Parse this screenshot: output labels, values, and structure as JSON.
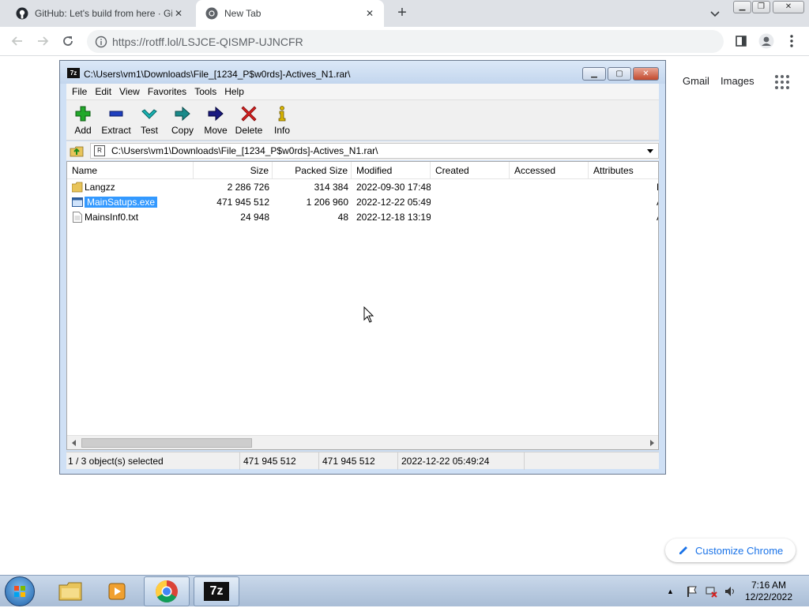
{
  "browser": {
    "tabs": [
      {
        "title": "GitHub: Let's build from here · GitHub",
        "active": false
      },
      {
        "title": "New Tab",
        "active": true
      }
    ],
    "url": "https://rotff.lol/LSJCE-QISMP-UJNCFR"
  },
  "google": {
    "gmail": "Gmail",
    "images": "Images",
    "customize": "Customize Chrome"
  },
  "sevenzip": {
    "title": "C:\\Users\\vm1\\Downloads\\File_[1234_P$w0rds]-Actives_N1.rar\\",
    "menu": [
      "File",
      "Edit",
      "View",
      "Favorites",
      "Tools",
      "Help"
    ],
    "toolbar": [
      {
        "label": "Add",
        "icon": "plus-icon",
        "color": "#22a82b"
      },
      {
        "label": "Extract",
        "icon": "minus-icon",
        "color": "#1f3fbf"
      },
      {
        "label": "Test",
        "icon": "check-icon",
        "color": "#19b3b3"
      },
      {
        "label": "Copy",
        "icon": "copy-arrow-icon",
        "color": "#1a8a8a"
      },
      {
        "label": "Move",
        "icon": "move-arrow-icon",
        "color": "#1a1a80"
      },
      {
        "label": "Delete",
        "icon": "delete-x-icon",
        "color": "#d42020"
      },
      {
        "label": "Info",
        "icon": "info-icon",
        "color": "#d8b400"
      }
    ],
    "address": "C:\\Users\\vm1\\Downloads\\File_[1234_P$w0rds]-Actives_N1.rar\\",
    "columns": [
      "Name",
      "Size",
      "Packed Size",
      "Modified",
      "Created",
      "Accessed",
      "Attributes"
    ],
    "rows": [
      {
        "name": "Langzz",
        "type": "folder",
        "size": "2 286 726",
        "packed": "314 384",
        "modified": "2022-09-30 17:48",
        "attr": "D",
        "selected": false
      },
      {
        "name": "MainSatups.exe",
        "type": "exe",
        "size": "471 945 512",
        "packed": "1 206 960",
        "modified": "2022-12-22 05:49",
        "attr": "A",
        "selected": true
      },
      {
        "name": "MainsInf0.txt",
        "type": "txt",
        "size": "24 948",
        "packed": "48",
        "modified": "2022-12-18 13:19",
        "attr": "A",
        "selected": false
      }
    ],
    "status": {
      "selected": "1 / 3 object(s) selected",
      "size": "471 945 512",
      "packed": "471 945 512",
      "modified": "2022-12-22 05:49:24"
    }
  },
  "taskbar": {
    "time": "7:16 AM",
    "date": "12/22/2022",
    "seven_zip_label": "7z"
  }
}
